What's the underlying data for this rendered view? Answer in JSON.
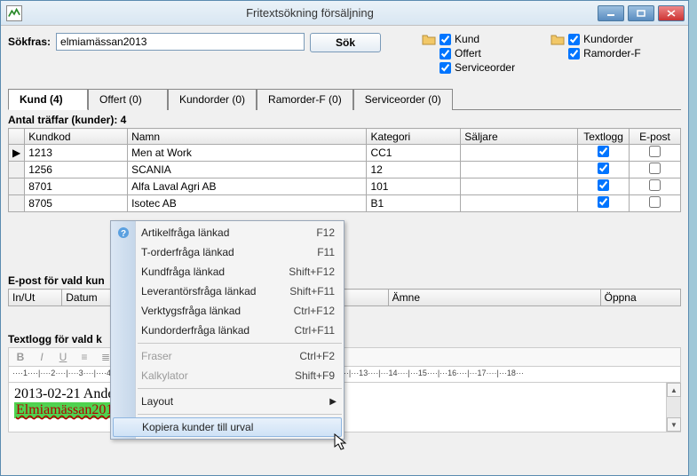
{
  "window": {
    "title": "Fritextsökning försäljning"
  },
  "search": {
    "label": "Sökfras:",
    "value": "elmiamässan2013",
    "button": "Sök"
  },
  "checkgroups": {
    "left": [
      {
        "label": "Kund",
        "checked": true
      },
      {
        "label": "Offert",
        "checked": true
      },
      {
        "label": "Serviceorder",
        "checked": true
      }
    ],
    "right": [
      {
        "label": "Kundorder",
        "checked": true
      },
      {
        "label": "Ramorder-F",
        "checked": true
      }
    ]
  },
  "tabs": [
    {
      "label": "Kund (4)",
      "active": true
    },
    {
      "label": "Offert (0)"
    },
    {
      "label": "Kundorder (0)"
    },
    {
      "label": "Ramorder-F (0)"
    },
    {
      "label": "Serviceorder (0)"
    }
  ],
  "hits_label": "Antal träffar (kunder): 4",
  "grid": {
    "cols": [
      "",
      "Kundkod",
      "Namn",
      "Kategori",
      "Säljare",
      "Textlogg",
      "E-post"
    ],
    "rows": [
      {
        "sel": "▶",
        "kundkod": "1213",
        "namn": "Men at Work",
        "kategori": "CC1",
        "saljare": "",
        "textlogg": true,
        "epost": false
      },
      {
        "sel": "",
        "kundkod": "1256",
        "namn": "SCANIA",
        "kategori": "12",
        "saljare": "",
        "textlogg": true,
        "epost": false
      },
      {
        "sel": "",
        "kundkod": "8701",
        "namn": "Alfa Laval Agri AB",
        "kategori": "101",
        "saljare": "",
        "textlogg": true,
        "epost": false
      },
      {
        "sel": "",
        "kundkod": "8705",
        "namn": "Isotec AB",
        "kategori": "B1",
        "saljare": "",
        "textlogg": true,
        "epost": false
      }
    ]
  },
  "email_section": {
    "label": "E-post för vald kun",
    "cols": [
      "In/Ut",
      "Datum",
      "",
      "Ämne",
      "Öppna"
    ]
  },
  "textlog_section": {
    "label": "Textlogg för vald k",
    "line1": "2013-02-21 Ande",
    "line2": "Elmiamässan201"
  },
  "ruler_text": "····1····|····2····|····3····|····4····|····5····|····6····|····7····|····8····|····9····|···10····|···11····|···12····|···13····|···14····|···15····|···16····|···17····|···18···",
  "ctxmenu": {
    "items": [
      {
        "label": "Artikelfråga länkad",
        "shortcut": "F12",
        "icon": true
      },
      {
        "label": "T-orderfråga länkad",
        "shortcut": "F11"
      },
      {
        "label": "Kundfråga länkad",
        "shortcut": "Shift+F12"
      },
      {
        "label": "Leverantörsfråga länkad",
        "shortcut": "Shift+F11"
      },
      {
        "label": "Verktygsfråga länkad",
        "shortcut": "Ctrl+F12"
      },
      {
        "label": "Kundorderfråga länkad",
        "shortcut": "Ctrl+F11"
      },
      {
        "sep": true
      },
      {
        "label": "Fraser",
        "shortcut": "Ctrl+F2",
        "disabled": true
      },
      {
        "label": "Kalkylator",
        "shortcut": "Shift+F9",
        "disabled": true
      },
      {
        "sep": true
      },
      {
        "label": "Layout",
        "submenu": true
      },
      {
        "sep": true
      },
      {
        "label": "Kopiera kunder till urval",
        "hover": true
      }
    ]
  }
}
